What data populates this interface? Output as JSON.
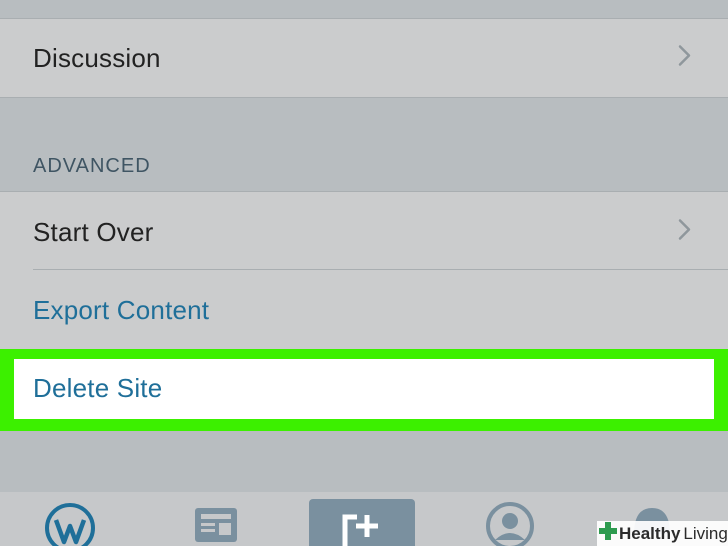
{
  "settings": {
    "discussion_label": "Discussion",
    "advanced_header": "ADVANCED",
    "start_over_label": "Start Over",
    "export_label": "Export Content",
    "delete_label": "Delete Site"
  },
  "tabbar": {
    "items": [
      "wordpress-logo",
      "reader-icon",
      "new-post-icon",
      "me-icon",
      "notifications-icon"
    ]
  },
  "watermark": {
    "brand_bold": "Healthy",
    "brand_rest": "Living"
  },
  "colors": {
    "link": "#1f6f99",
    "highlight": "#3cf000",
    "tab_accent": "#1f6f99",
    "tab_inactive": "#7a909f"
  }
}
